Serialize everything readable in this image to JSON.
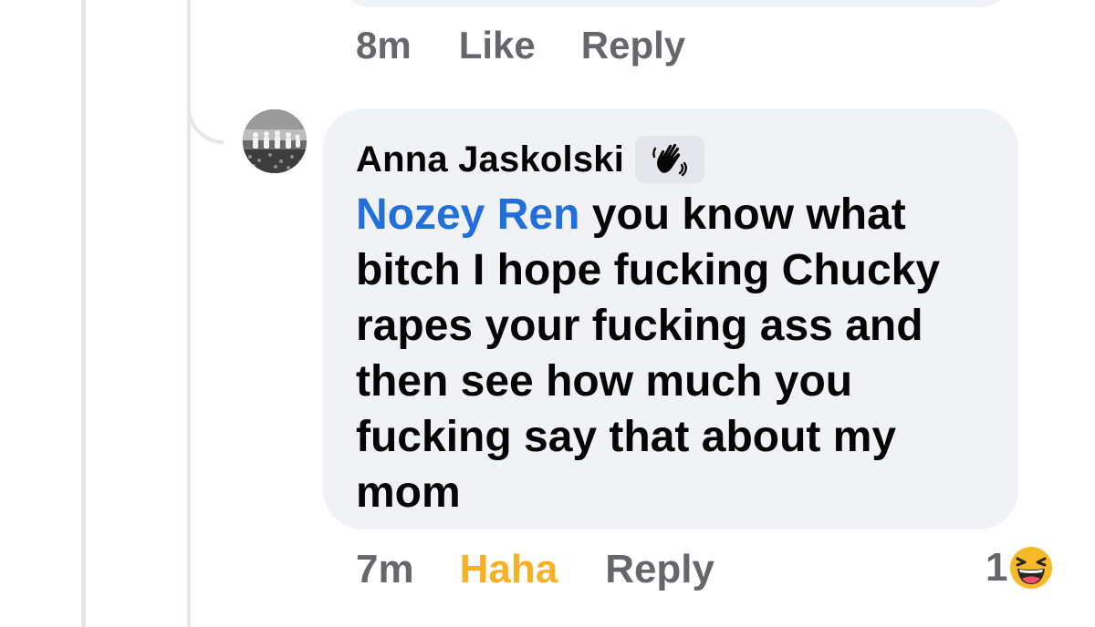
{
  "previous_comment": {
    "time": "8m",
    "like_label": "Like",
    "reply_label": "Reply"
  },
  "comment": {
    "author": "Anna Jaskolski",
    "badge_icon": "waving-hand-icon",
    "mention": "Nozey Ren",
    "text": " you know what bitch I hope fucking Chucky rapes your fucking ass and then see how much you fucking say that about my mom",
    "time": "7m",
    "reaction_label": "Haha",
    "reply_label": "Reply",
    "reaction_count": "1",
    "reaction_icon": "laughing-emoji-icon"
  },
  "colors": {
    "bubble": "#f0f2f5",
    "mention": "#216fdb",
    "haha": "#f7b125",
    "meta": "#65676b",
    "text": "#050505"
  }
}
